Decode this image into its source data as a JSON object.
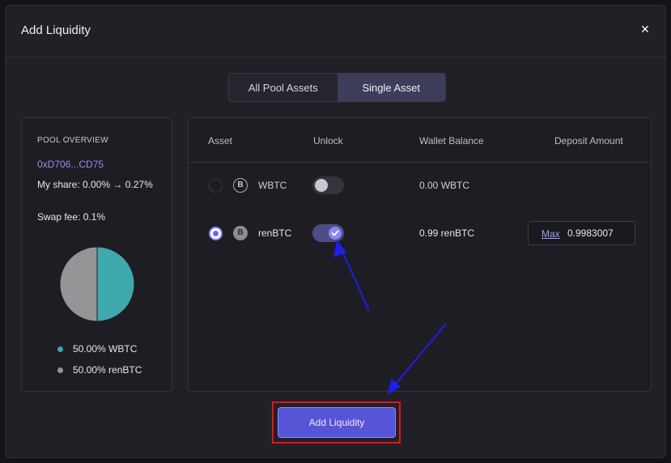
{
  "modal": {
    "title": "Add Liquidity",
    "close_symbol": "×"
  },
  "mode_tabs": [
    {
      "label": "All Pool Assets",
      "active": false
    },
    {
      "label": "Single Asset",
      "active": true
    }
  ],
  "overview": {
    "title": "POOL OVERVIEW",
    "address": "0xD706...CD75",
    "share": "My share: 0.00% → 0.27%",
    "swap_fee": "Swap fee: 0.1%",
    "pie": [
      {
        "label": "50.00% WBTC",
        "percent": 50,
        "color": "#3fa8ad"
      },
      {
        "label": "50.00% renBTC",
        "percent": 50,
        "color": "#959597"
      }
    ]
  },
  "table": {
    "headers": {
      "asset": "Asset",
      "unlock": "Unlock",
      "balance": "Wallet Balance",
      "deposit": "Deposit Amount"
    },
    "rows": [
      {
        "selected": false,
        "coin_icon": "bitcoin-icon",
        "coin_symbol": "B",
        "name": "WBTC",
        "unlocked": false,
        "balance": "0.00 WBTC"
      },
      {
        "selected": true,
        "coin_icon": "bitcoin-icon",
        "coin_symbol": "B",
        "name": "renBTC",
        "unlocked": true,
        "balance": "0.99 renBTC",
        "max_label": "Max",
        "deposit_value": "0.9983007"
      }
    ]
  },
  "actions": {
    "submit_label": "Add Liquidity"
  },
  "colors": {
    "accent": "#5755d6",
    "highlight_box": "#e3151a",
    "annotation_arrow": "#1f1fe6"
  }
}
